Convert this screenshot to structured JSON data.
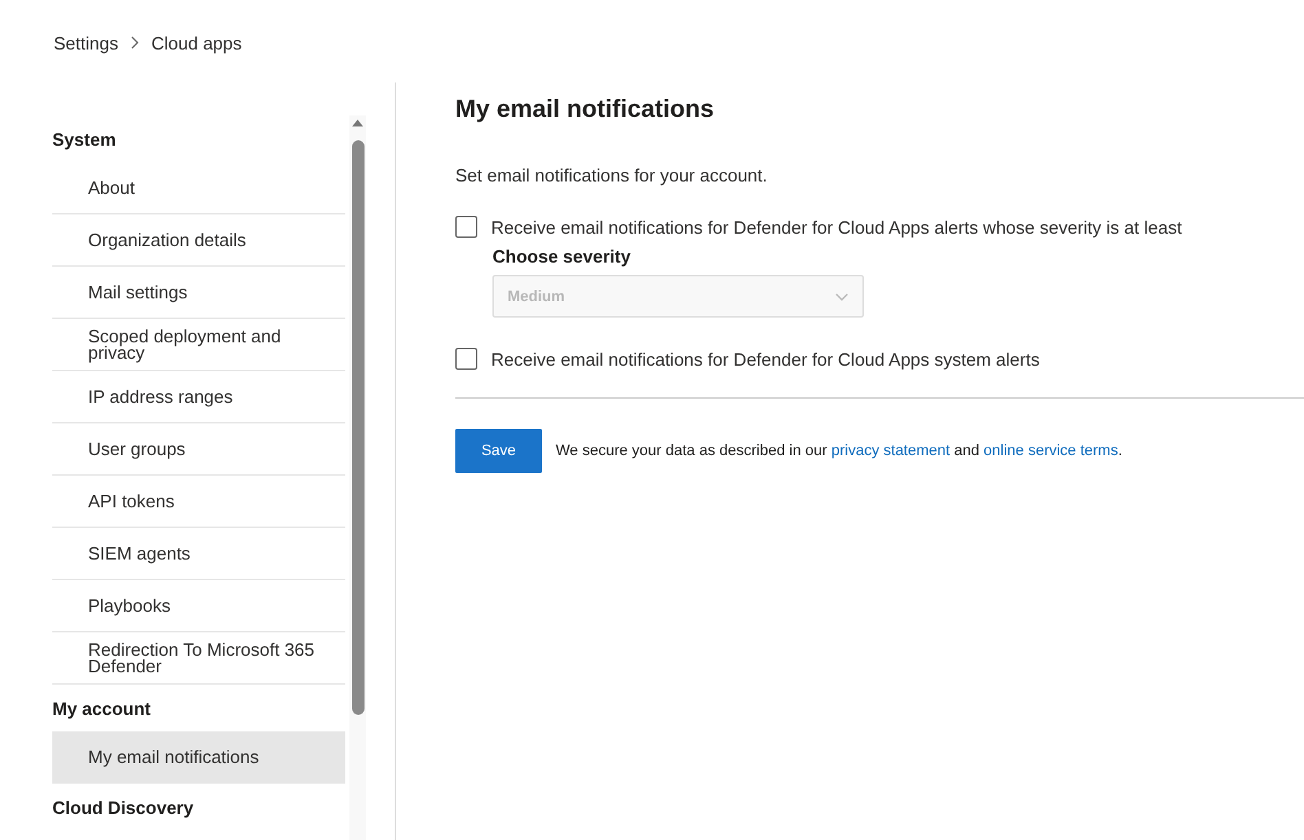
{
  "breadcrumb": [
    {
      "label": "Settings"
    },
    {
      "label": "Cloud apps"
    }
  ],
  "sidebar": {
    "groups": [
      {
        "title": "System",
        "items": [
          {
            "label": "About",
            "selected": false
          },
          {
            "label": "Organization details",
            "selected": false
          },
          {
            "label": "Mail settings",
            "selected": false
          },
          {
            "label": "Scoped deployment and privacy",
            "selected": false
          },
          {
            "label": "IP address ranges",
            "selected": false
          },
          {
            "label": "User groups",
            "selected": false
          },
          {
            "label": "API tokens",
            "selected": false
          },
          {
            "label": "SIEM agents",
            "selected": false
          },
          {
            "label": "Playbooks",
            "selected": false
          },
          {
            "label": "Redirection To Microsoft 365 Defender",
            "selected": false
          }
        ]
      },
      {
        "title": "My account",
        "items": [
          {
            "label": "My email notifications",
            "selected": true
          }
        ]
      },
      {
        "title": "Cloud Discovery"
      }
    ]
  },
  "content": {
    "title": "My email notifications",
    "description": "Set email notifications for your account.",
    "options": [
      {
        "kind": "checkbox",
        "label": "Receive email notifications for Defender for Cloud Apps alerts whose severity is at least",
        "checked": false
      },
      {
        "kind": "dropdown",
        "label": "Choose severity",
        "value": "Medium",
        "disabled": true
      },
      {
        "kind": "checkbox",
        "label": "Receive email notifications for Defender for Cloud Apps system alerts",
        "checked": false
      }
    ],
    "save_button": "Save",
    "notice": [
      {
        "kind": "text",
        "text": "We secure your data as described in our "
      },
      {
        "kind": "link",
        "text": "privacy statement"
      },
      {
        "kind": "text",
        "text": " and "
      },
      {
        "kind": "link",
        "text": "online service terms"
      },
      {
        "kind": "text",
        "text": "."
      }
    ]
  }
}
